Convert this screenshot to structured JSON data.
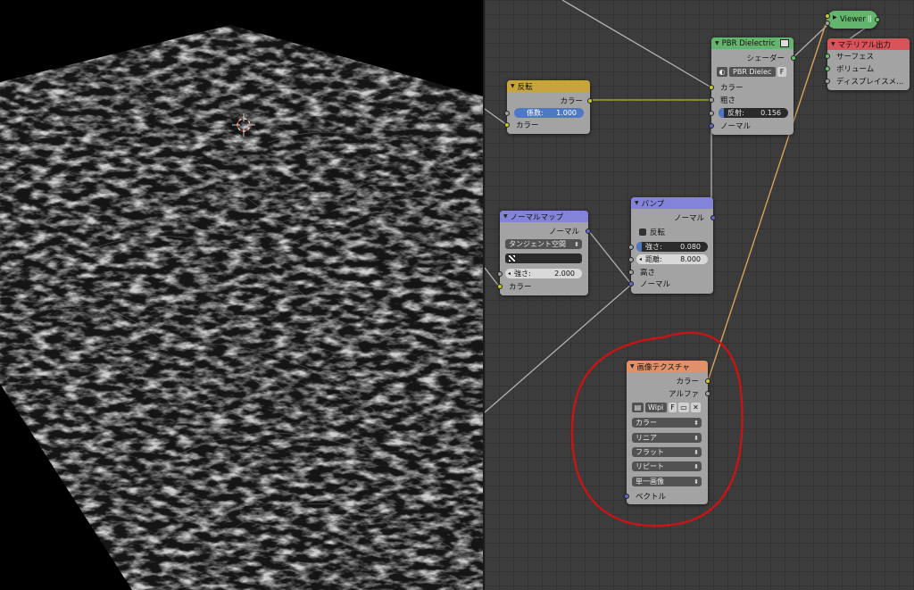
{
  "nodes": {
    "invert": {
      "title": "反転",
      "out_color": "カラー",
      "factor_label": "係数:",
      "factor_value": "1.000",
      "in_color": "カラー"
    },
    "pbr": {
      "title": "PBR Dielectric",
      "out_shader": "シェーダー",
      "shader_name": "PBR Dielec",
      "fake_user": "F",
      "in_color": "カラー",
      "roughness": "粗さ",
      "reflection_label": "反射:",
      "reflection_value": "0.156",
      "in_normal": "ノーマル"
    },
    "viewer": {
      "title": "Viewer"
    },
    "material_output": {
      "title": "マテリアル出力",
      "surface": "サーフェス",
      "volume": "ボリューム",
      "displacement": "ディスプレイスメ..."
    },
    "normal_map": {
      "title": "ノーマルマップ",
      "out_normal": "ノーマル",
      "space": "タンジェント空間",
      "strength_label": "強さ:",
      "strength_value": "2.000",
      "in_color": "カラー"
    },
    "bump": {
      "title": "バンプ",
      "out_normal": "ノーマル",
      "invert": "反転",
      "strength_label": "強さ:",
      "strength_value": "0.080",
      "distance_label": "距離:",
      "distance_value": "8.000",
      "in_height": "高さ",
      "in_normal": "ノーマル"
    },
    "image_texture": {
      "title": "画像テクスチャ",
      "out_color": "カラー",
      "out_alpha": "アルファ",
      "image_name": "Wipi",
      "fake_user": "F",
      "color_space": "カラー",
      "interpolation": "リニア",
      "projection": "フラット",
      "extension": "リピート",
      "source": "単一画像",
      "in_vector": "ベクトル"
    }
  },
  "colors": {
    "header_converter": "#c9a43d",
    "header_shader": "#63b56d",
    "header_output": "#d8535a",
    "header_vector": "#8383d9",
    "header_texture": "#e0916a",
    "annotation_circle": "#c81414",
    "link_color": "#d6a15a"
  },
  "icons": [
    "sphere-icon",
    "checker-icon",
    "image-icon",
    "folder-icon",
    "close-icon",
    "cursor-icon"
  ]
}
